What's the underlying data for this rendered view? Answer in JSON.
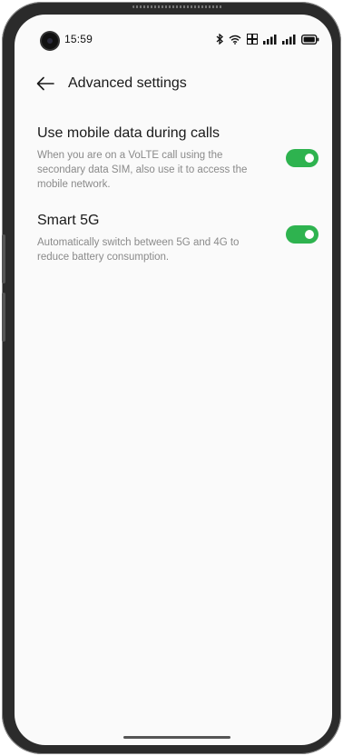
{
  "status_bar": {
    "time": "15:59",
    "icons": [
      "bluetooth-icon",
      "wifi-icon",
      "volte-hd-icon",
      "signal-icon-sim1",
      "signal-icon-sim2",
      "battery-icon"
    ]
  },
  "header": {
    "back_icon": "arrow-left-icon",
    "title": "Advanced settings"
  },
  "settings": [
    {
      "title": "Use mobile data during calls",
      "description": "When you are on a VoLTE call using the secondary data SIM, also use it to access the mobile network.",
      "enabled": true
    },
    {
      "title": "Smart 5G",
      "description": "Automatically switch between 5G and 4G to reduce battery consumption.",
      "enabled": true
    }
  ],
  "colors": {
    "toggle_on": "#2eb34f",
    "background": "#fafafa",
    "primary_text": "#1a1a1a",
    "secondary_text": "#8a8a8a"
  }
}
